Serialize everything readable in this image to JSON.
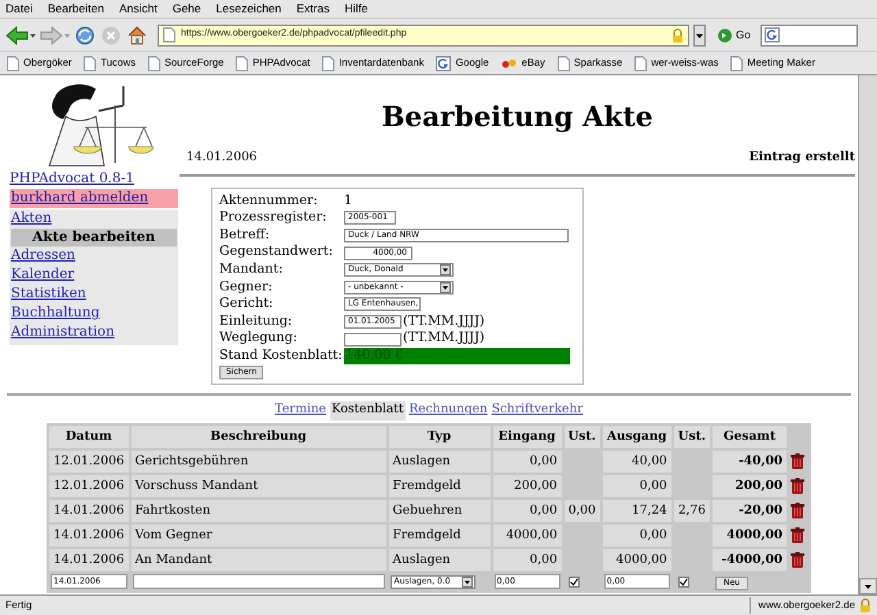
{
  "menu": [
    "Datei",
    "Bearbeiten",
    "Ansicht",
    "Gehe",
    "Lesezeichen",
    "Extras",
    "Hilfe"
  ],
  "toolbar": {
    "url": "https://www.obergoeker2.de/phpadvocat/pfileedit.php",
    "go": "Go"
  },
  "bookmarks": [
    {
      "label": "Obergöker",
      "kind": "page"
    },
    {
      "label": "Tucows",
      "kind": "page"
    },
    {
      "label": "SourceForge",
      "kind": "page"
    },
    {
      "label": "PHPAdvocat",
      "kind": "page"
    },
    {
      "label": "Inventardatenbank",
      "kind": "page"
    },
    {
      "label": "Google",
      "kind": "google"
    },
    {
      "label": "eBay",
      "kind": "ebay"
    },
    {
      "label": "Sparkasse",
      "kind": "page"
    },
    {
      "label": "wer-weiss-was",
      "kind": "page"
    },
    {
      "label": "Meeting Maker",
      "kind": "page"
    }
  ],
  "sidebar": {
    "version": "PHPAdvocat 0.8-1",
    "logout": "burkhard abmelden",
    "items": [
      {
        "label": "Akten",
        "selected": false
      },
      {
        "label": "Akte bearbeiten",
        "selected": true
      },
      {
        "label": "Adressen",
        "selected": false
      },
      {
        "label": "Kalender",
        "selected": false
      },
      {
        "label": "Statistiken",
        "selected": false
      },
      {
        "label": "Buchhaltung",
        "selected": false
      },
      {
        "label": "Administration",
        "selected": false
      }
    ]
  },
  "page": {
    "title": "Bearbeitung Akte",
    "date": "14.01.2006",
    "action": "Eintrag erstellt"
  },
  "form": {
    "fields": [
      {
        "label": "Aktennummer:",
        "kind": "static",
        "value": "1"
      },
      {
        "label": "Prozessregister:",
        "kind": "short",
        "value": "2005-001"
      },
      {
        "label": "Betreff:",
        "kind": "wide",
        "value": "Duck / Land NRW"
      },
      {
        "label": "Gegenstandwert:",
        "kind": "amount",
        "value": "4000,00"
      },
      {
        "label": "Mandant:",
        "kind": "select",
        "value": "Duck, Donald"
      },
      {
        "label": "Gegner:",
        "kind": "select",
        "value": "- unbekannt -"
      },
      {
        "label": "Gericht:",
        "kind": "smallselect",
        "value": "LG Entenhausen,"
      },
      {
        "label": "Einleitung:",
        "kind": "date",
        "value": "01.01.2005",
        "hint": "(TT.MM.JJJJ)"
      },
      {
        "label": "Weglegung:",
        "kind": "date",
        "hint": "(TT.MM.JJJJ)"
      },
      {
        "label": "Stand Kostenblatt:",
        "kind": "balance",
        "value": "140,00 €"
      }
    ],
    "submit": "Sichern"
  },
  "tabs": [
    {
      "label": "Termine",
      "selected": false
    },
    {
      "label": "Kostenblatt",
      "selected": true
    },
    {
      "label": "Rechnungen",
      "selected": false
    },
    {
      "label": "Schriftverkehr",
      "selected": false
    }
  ],
  "table": {
    "columns": [
      "Datum",
      "Beschreibung",
      "Typ",
      "Eingang",
      "Ust.",
      "Ausgang",
      "Ust.",
      "Gesamt"
    ],
    "rows": [
      {
        "datum": "12.01.2006",
        "beschreibung": "Gerichtsgebühren",
        "typ": "Auslagen",
        "eingang": "0,00",
        "ausgang": "40,00",
        "gesamt": "-40,00"
      },
      {
        "datum": "12.01.2006",
        "beschreibung": "Vorschuss Mandant",
        "typ": "Fremdgeld",
        "eingang": "200,00",
        "ausgang": "0,00",
        "gesamt": "200,00"
      },
      {
        "datum": "14.01.2006",
        "beschreibung": "Fahrtkosten",
        "typ": "Gebuehren",
        "eingang": "0,00",
        "ust_eingang": "0,00",
        "ausgang": "17,24",
        "ust_ausgang": "2,76",
        "gesamt": "-20,00"
      },
      {
        "datum": "14.01.2006",
        "beschreibung": "Vom Gegner",
        "typ": "Fremdgeld",
        "eingang": "4000,00",
        "ausgang": "0,00",
        "gesamt": "4000,00"
      },
      {
        "datum": "14.01.2006",
        "beschreibung": "An Mandant",
        "typ": "Auslagen",
        "eingang": "0,00",
        "ausgang": "4000,00",
        "gesamt": "-4000,00"
      }
    ],
    "new_row": {
      "datum": "14.01.2006",
      "typ": "Auslagen, 0.0",
      "eingang": "0,00",
      "ust_eingang": true,
      "ausgang": "0,00",
      "ust_ausgang": true,
      "button": "Neu"
    }
  },
  "status": {
    "text": "Fertig",
    "host": "www.obergoeker2.de"
  }
}
